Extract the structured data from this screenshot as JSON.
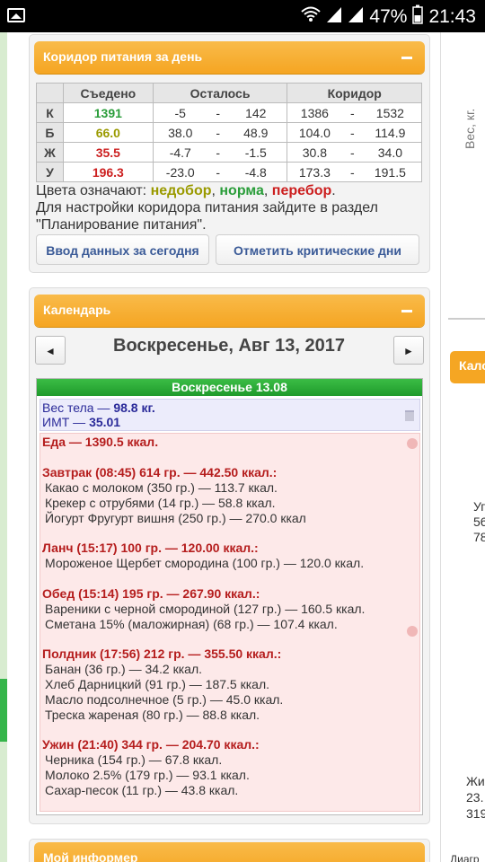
{
  "status_bar": {
    "battery": "47%",
    "time": "21:43"
  },
  "corridor_panel": {
    "title": "Коридор питания за день",
    "headers": [
      "Съедено",
      "Осталось",
      "Коридор"
    ],
    "rows": [
      {
        "label": "К",
        "eaten": "1391",
        "eaten_color": "green",
        "left_min": "-5",
        "left_max": "142",
        "corr_min": "1386",
        "corr_max": "1532"
      },
      {
        "label": "Б",
        "eaten": "66.0",
        "eaten_color": "olive",
        "left_min": "38.0",
        "left_max": "48.9",
        "corr_min": "104.0",
        "corr_max": "114.9"
      },
      {
        "label": "Ж",
        "eaten": "35.5",
        "eaten_color": "red",
        "left_min": "-4.7",
        "left_max": "-1.5",
        "corr_min": "30.8",
        "corr_max": "34.0"
      },
      {
        "label": "У",
        "eaten": "196.3",
        "eaten_color": "red",
        "left_min": "-23.0",
        "left_max": "-4.8",
        "corr_min": "173.3",
        "corr_max": "191.5"
      }
    ],
    "legend_prefix": "Цвета означают:",
    "legend_under": "недобор",
    "legend_norm": "норма",
    "legend_over": "перебор",
    "hint": "Для настройки коридора питания зайдите в раздел \"Планирование питания\".",
    "button_today": "Ввод данных за сегодня",
    "button_critical": "Отметить критические дни"
  },
  "calendar_panel": {
    "title": "Календарь",
    "prev": "◄",
    "next": "►",
    "date": "Воскресенье, Авг 13, 2017",
    "day_title": "Воскресенье 13.08",
    "weight_label": "Вес тела —",
    "weight_value": "98.8 кг.",
    "bmi_label": "ИМТ —",
    "bmi_value": "35.01",
    "food_label": "Еда —",
    "food_total": "1390.5 ккал.",
    "meals": [
      {
        "head": "Завтрак (08:45) 614 гр. — 442.50 ккал.:",
        "items": [
          "Какао с молоком (350 гр.) — 113.7 ккал.",
          "Крекер с отрубями (14 гр.) — 58.8 ккал.",
          "Йогурт Фругурт вишня (250 гр.) — 270.0 ккал"
        ]
      },
      {
        "head": "Ланч (15:17) 100 гр. — 120.00 ккал.:",
        "items": [
          "Мороженое Щербет смородина (100 гр.) — 120.0 ккал."
        ]
      },
      {
        "head": "Обед (15:14) 195 гр. — 267.90 ккал.:",
        "items": [
          "Вареники с черной смородиной (127 гр.) — 160.5 ккал.",
          "Сметана 15% (маложирная) (68 гр.) — 107.4 ккал."
        ]
      },
      {
        "head": "Полдник (17:56) 212 гр. — 355.50 ккал.:",
        "items": [
          "Банан (36 гр.) — 34.2 ккал.",
          "Хлеб Дарницкий (91 гр.) — 187.5 ккал.",
          "Масло подсолнечное (5 гр.) — 45.0 ккал.",
          "Треска жареная (80 гр.) — 88.8 ккал."
        ]
      },
      {
        "head": "Ужин (21:40) 344 гр. — 204.70 ккал.:",
        "items": [
          "Черника (154 гр.) — 67.8 ккал.",
          "Молоко 2.5% (179 гр.) — 93.1 ккал.",
          "Сахар-песок (11 гр.) — 43.8 ккал."
        ]
      }
    ]
  },
  "informer_panel": {
    "title": "Мой информер"
  },
  "right_column": {
    "weight_axis": "Вес, кг.",
    "header": "Кало",
    "t1": "Уг",
    "t2": "56",
    "t3": "78",
    "t4": "Жи",
    "t5": "23.",
    "t6": "319",
    "t7": "Диагр"
  },
  "colors": {
    "accent": "#f5a623",
    "green": "#2a9d3a",
    "olive": "#9a9a00",
    "red": "#cc1f1f",
    "link": "#3a5a97"
  }
}
